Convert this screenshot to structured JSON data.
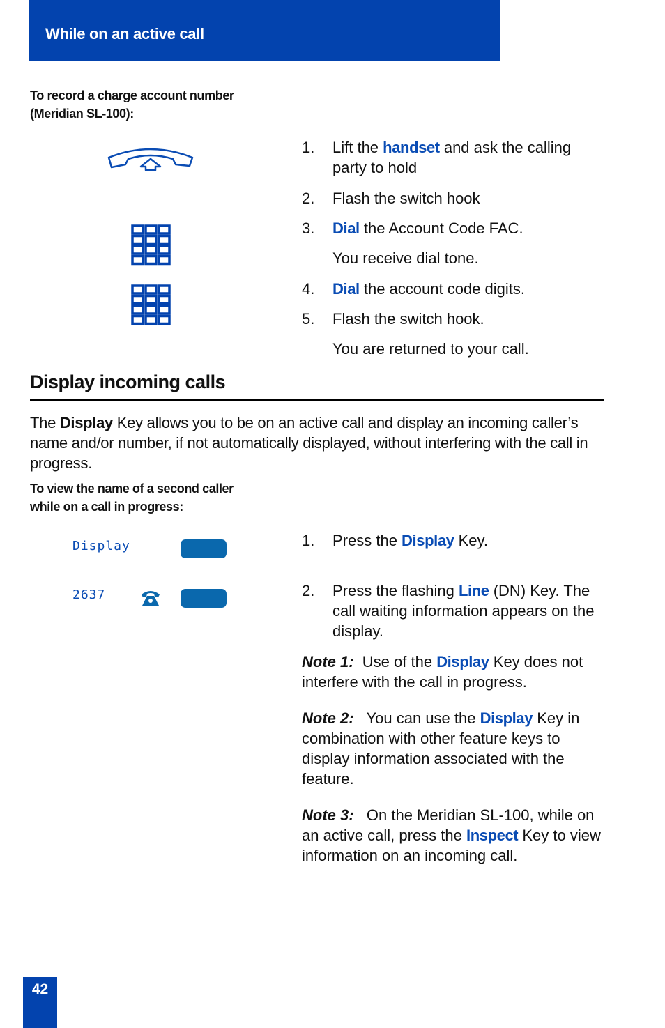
{
  "header": {
    "title": "While on an active call"
  },
  "charge_account": {
    "subheading_line1": "To record a charge account number",
    "subheading_line2": "(Meridian SL-100):",
    "icons": [
      "handset-off-hook-icon",
      "dialpad-icon",
      "dialpad-icon"
    ],
    "steps": [
      {
        "num": "1.",
        "parts": [
          {
            "t": "Lift the "
          },
          {
            "t": "handset",
            "hl": true
          },
          {
            "t": " and ask the calling party to hold"
          }
        ]
      },
      {
        "num": "2.",
        "parts": [
          {
            "t": "Flash the switch hook"
          }
        ]
      },
      {
        "num": "3.",
        "parts": [
          {
            "t": "Dial",
            "hl": true
          },
          {
            "t": " the Account Code FAC."
          }
        ]
      },
      {
        "num": "",
        "parts": [
          {
            "t": "You receive dial tone."
          }
        ]
      },
      {
        "num": "4.",
        "parts": [
          {
            "t": "Dial",
            "hl": true
          },
          {
            "t": " the account code digits."
          }
        ]
      },
      {
        "num": "5.",
        "parts": [
          {
            "t": "Flash the switch hook."
          }
        ]
      },
      {
        "num": "",
        "parts": [
          {
            "t": "You are returned to your call."
          }
        ]
      }
    ]
  },
  "display_section": {
    "title": "Display incoming calls",
    "intro_prefix": "The ",
    "intro_bold": "Display",
    "intro_rest": " Key allows you to be on an active call and display an incoming caller’s name and/or number, if not automatically displayed, without interfering with the call in progress.",
    "subheading_line1": "To view the name of a second caller",
    "subheading_line2": "while on a call in progress:",
    "lcd": {
      "display_label": "Display",
      "line_number": "2637"
    },
    "steps": [
      {
        "num": "1.",
        "parts": [
          {
            "t": "Press the "
          },
          {
            "t": "Display",
            "hl": true
          },
          {
            "t": " Key."
          }
        ]
      },
      {
        "num": "2.",
        "parts": [
          {
            "t": "Press the flashing "
          },
          {
            "t": "Line",
            "hl": true
          },
          {
            "t": " (DN) Key. The call waiting information appears on the display."
          }
        ]
      }
    ],
    "notes": [
      {
        "label": "Note 1:",
        "parts": [
          {
            "t": "  Use of the "
          },
          {
            "t": "Display",
            "hl": true
          },
          {
            "t": " Key does not interfere with the call in progress."
          }
        ]
      },
      {
        "label": "Note 2:",
        "parts": [
          {
            "t": "   You can use the "
          },
          {
            "t": "Display",
            "hl": true
          },
          {
            "t": " Key in combination with other feature keys to display information associated with the feature."
          }
        ]
      },
      {
        "label": "Note 3:",
        "parts": [
          {
            "t": "   On the Meridian SL-100, while on an active call, press the "
          },
          {
            "t": "Inspect",
            "hl": true
          },
          {
            "t": " Key to view information on an incoming call."
          }
        ]
      }
    ]
  },
  "footer": {
    "page_number": "42"
  },
  "colors": {
    "brand_blue": "#0343ae",
    "highlight_blue": "#0a4cb4",
    "softkey_blue": "#0a68ad"
  }
}
